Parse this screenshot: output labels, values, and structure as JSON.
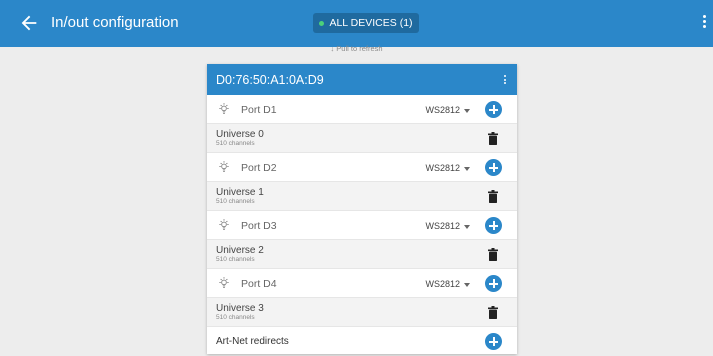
{
  "appbar": {
    "title": "In/out configuration",
    "devices_button": "ALL DEVICES (1)",
    "back_icon": "arrow-left-icon",
    "menu_icon": "more-vertical-icon",
    "status_dot_color": "#4cd07a",
    "background": "#2b87c9"
  },
  "pull_hint": "↓ Pull to refresh",
  "device": {
    "name": "D0:76:50:A1:0A:D9",
    "ports": [
      {
        "label": "Port D1",
        "type": "WS2812",
        "universe": "Universe 0",
        "channels": "510 channels"
      },
      {
        "label": "Port D2",
        "type": "WS2812",
        "universe": "Universe 1",
        "channels": "510 channels"
      },
      {
        "label": "Port D3",
        "type": "WS2812",
        "universe": "Universe 2",
        "channels": "510 channels"
      },
      {
        "label": "Port D4",
        "type": "WS2812",
        "universe": "Universe 3",
        "channels": "510 channels"
      }
    ],
    "redirects_label": "Art-Net redirects"
  }
}
